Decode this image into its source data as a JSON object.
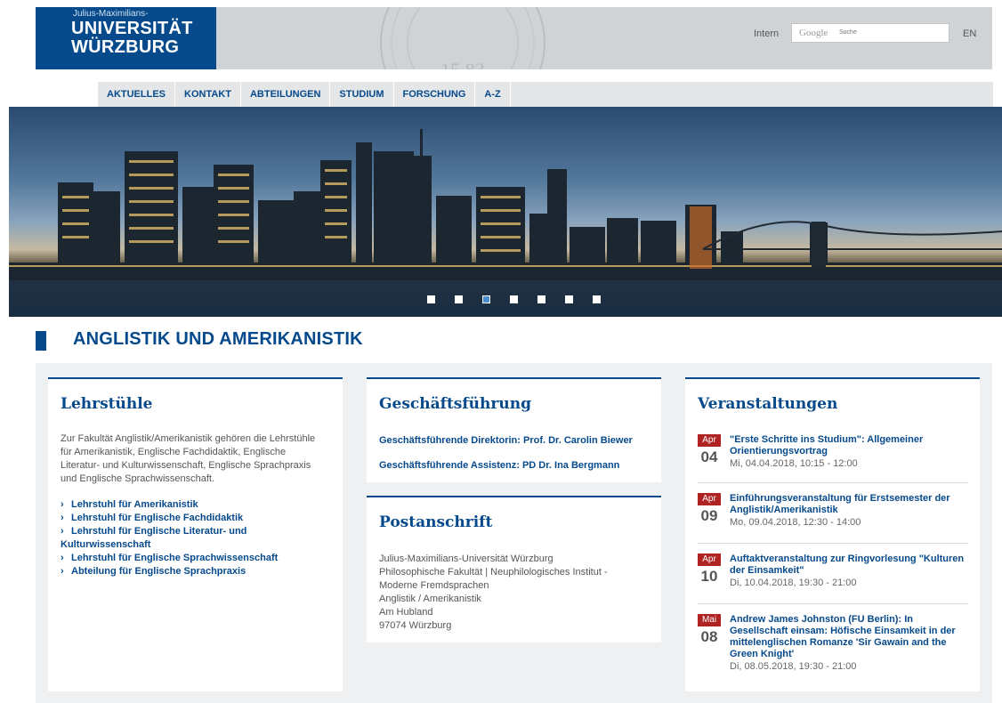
{
  "header": {
    "logo_small": "Julius-Maximilians-",
    "logo_line1": "UNIVERSITÄT",
    "logo_line2": "WÜRZBURG",
    "intern": "Intern",
    "search_brand": "Google",
    "search_placeholder": "Suche",
    "lang": "EN",
    "seal_text": "15 83"
  },
  "nav": [
    "AKTUELLES",
    "KONTAKT",
    "ABTEILUNGEN",
    "STUDIUM",
    "FORSCHUNG",
    "A-Z"
  ],
  "slider": {
    "count": 7,
    "active_index": 2
  },
  "page_title": "ANGLISTIK UND AMERIKANISTIK",
  "lehrstuehle": {
    "heading": "Lehrstühle",
    "text": "Zur Fakultät Anglistik/Amerikanistik gehören die Lehrstühle für Amerikanistik, Englische Fachdidaktik, Englische Literatur- und Kulturwissenschaft, Englische Sprachpraxis und Englische Sprachwissenschaft.",
    "links": [
      "Lehrstuhl für Amerikanistik",
      "Lehrstuhl für Englische Fachdidaktik",
      "Lehrstuhl für Englische Literatur- und Kulturwissenschaft",
      "Lehrstuhl für Englische Sprachwissenschaft",
      "Abteilung für Englische Sprachpraxis"
    ]
  },
  "geschaeftsfuehrung": {
    "heading": "Geschäftsführung",
    "lines": [
      "Geschäftsführende Direktorin:  Prof. Dr. Carolin Biewer",
      "Geschäftsführende Assistenz: PD Dr. Ina Bergmann"
    ]
  },
  "postanschrift": {
    "heading": "Postanschrift",
    "lines": [
      "Julius-Maximilians-Universität Würzburg",
      "Philosophische Fakultät | Neuphilologisches Institut -",
      "Moderne Fremdsprachen",
      "Anglistik / Amerikanistik",
      "Am Hubland",
      "97074 Würzburg"
    ]
  },
  "veranstaltungen": {
    "heading": "Veranstaltungen",
    "events": [
      {
        "month": "Apr",
        "day": "04",
        "title": "\"Erste Schritte ins Studium\": Allgemeiner Orientierungsvortrag",
        "date": "Mi, 04.04.2018, 10:15 - 12:00"
      },
      {
        "month": "Apr",
        "day": "09",
        "title": "Einführungsveranstaltung für Erstsemester der Anglistik/Amerikanistik",
        "date": "Mo, 09.04.2018, 12:30 - 14:00"
      },
      {
        "month": "Apr",
        "day": "10",
        "title": "Auftaktveranstaltung zur Ringvorlesung \"Kulturen der Einsamkeit\"",
        "date": "Di, 10.04.2018, 19:30 - 21:00"
      },
      {
        "month": "Mai",
        "day": "08",
        "title": "Andrew James Johnston (FU Berlin): In Gesellschaft einsam: Höfische Einsamkeit in der mittelenglischen Romanze 'Sir Gawain and the Green Knight'",
        "date": "Di, 08.05.2018, 19:30 - 21:00"
      }
    ]
  },
  "colors": {
    "brand": "#064a8c",
    "event_badge": "#b02323",
    "content_bg": "#eef0f1"
  }
}
